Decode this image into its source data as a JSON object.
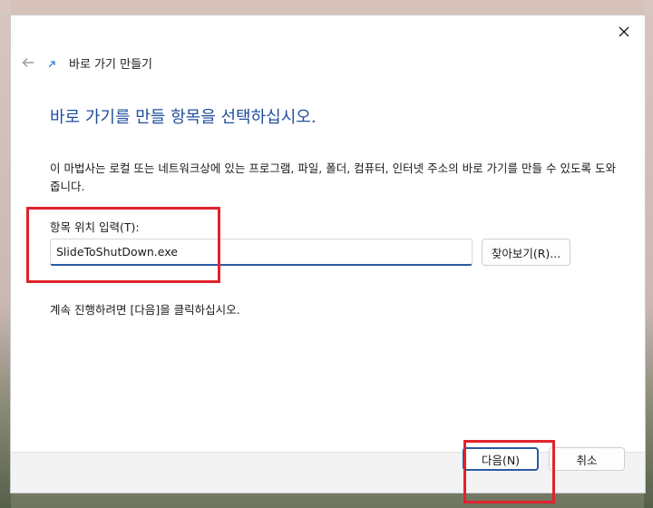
{
  "window": {
    "title": "바로 가기 만들기",
    "close_icon": "close-icon",
    "back_icon": "back-arrow-icon"
  },
  "main": {
    "heading": "바로 가기를 만들 항목을 선택하십시오.",
    "description": "이 마법사는 로컬 또는 네트워크상에 있는 프로그램, 파일, 폴더, 컴퓨터, 인터넷 주소의 바로 가기를 만들 수 있도록 도와줍니다.",
    "field_label": "항목 위치 입력(T):",
    "location_value": "SlideToShutDown.exe",
    "browse_label": "찾아보기(R)...",
    "continue_text": "계속 진행하려면 [다음]을 클릭하십시오."
  },
  "footer": {
    "next_label": "다음(N)",
    "cancel_label": "취소"
  },
  "colors": {
    "accent": "#2b5aa3",
    "heading": "#1f4e9b",
    "annotation": "#e0232e"
  }
}
